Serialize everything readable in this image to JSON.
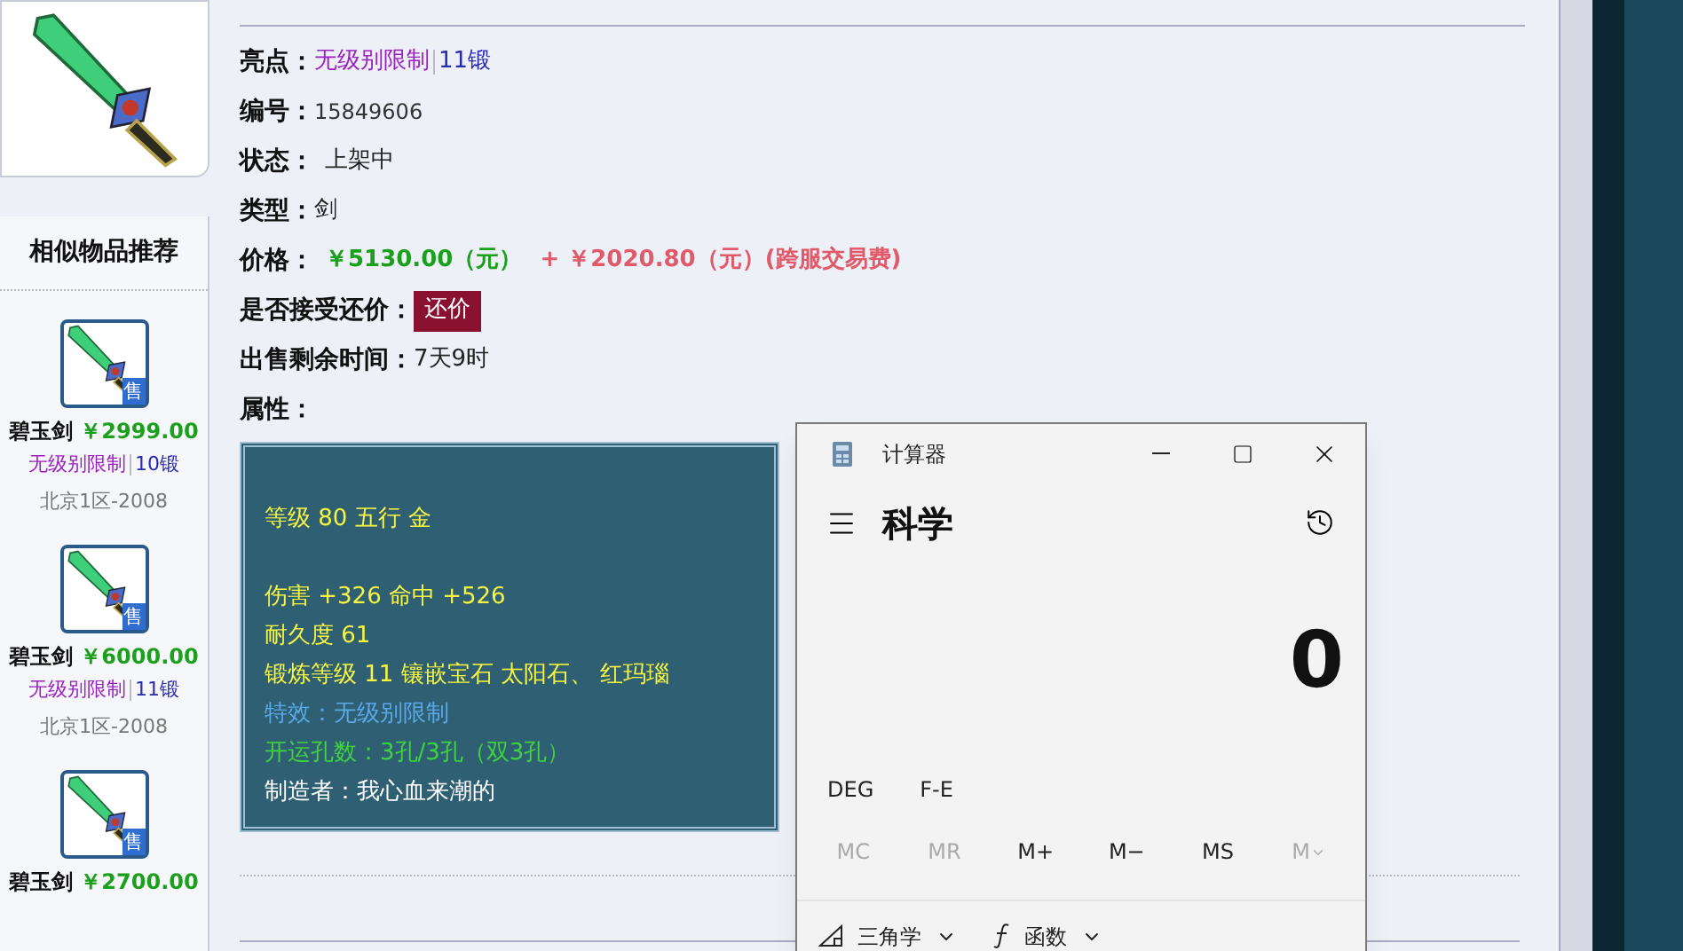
{
  "sidebar": {
    "title": "相似物品推荐",
    "items": [
      {
        "name": "碧玉剑",
        "price": "￥2999.00",
        "tag": "无级别限制",
        "forge": "10锻",
        "server": "北京1区-2008",
        "badge": "售"
      },
      {
        "name": "碧玉剑",
        "price": "￥6000.00",
        "tag": "无级别限制",
        "forge": "11锻",
        "server": "北京1区-2008",
        "badge": "售"
      },
      {
        "name": "碧玉剑",
        "price": "￥2700.00",
        "badge": "售"
      }
    ]
  },
  "details": {
    "highlight": {
      "label": "亮点：",
      "tag": "无级别限制",
      "forge": "11锻"
    },
    "number": {
      "label": "编号：",
      "value": "15849606"
    },
    "status": {
      "label": "状态：",
      "value": "上架中"
    },
    "type": {
      "label": "类型：",
      "value": "剑"
    },
    "price": {
      "label": "价格：",
      "value": "￥5130.00（元）",
      "fee": "+ ￥2020.80（元）(跨服交易费)"
    },
    "bargain": {
      "label": "是否接受还价：",
      "button": "还价"
    },
    "remaining": {
      "label": "出售剩余时间：",
      "value": "7天9时"
    },
    "attributes_label": "属性：",
    "attributes": [
      {
        "kind": "gap"
      },
      {
        "kind": "stat",
        "text": "等级 80 五行 金"
      },
      {
        "kind": "gap"
      },
      {
        "kind": "stat",
        "text": "伤害 +326 命中 +526"
      },
      {
        "kind": "stat",
        "text": "耐久度 61"
      },
      {
        "kind": "stat",
        "text": "锻炼等级 11 镶嵌宝石 太阳石、 红玛瑙"
      },
      {
        "kind": "effect",
        "text": "特效：无级别限制"
      },
      {
        "kind": "holes",
        "text": "开运孔数：3孔/3孔（双3孔）"
      },
      {
        "kind": "maker",
        "text": "制造者：我心血来潮的"
      }
    ]
  },
  "calculator": {
    "title": "计算器",
    "mode": "科学",
    "display": "0",
    "toggles": [
      "DEG",
      "F-E"
    ],
    "memory": [
      {
        "label": "MC",
        "disabled": true
      },
      {
        "label": "MR",
        "disabled": true
      },
      {
        "label": "M+",
        "disabled": false
      },
      {
        "label": "M−",
        "disabled": false
      },
      {
        "label": "MS",
        "disabled": false
      },
      {
        "label": "M",
        "disabled": true,
        "kind": "dropdown"
      }
    ],
    "menus": [
      {
        "label": "三角学",
        "kind": "trig"
      },
      {
        "label": "函数",
        "kind": "func"
      }
    ]
  }
}
